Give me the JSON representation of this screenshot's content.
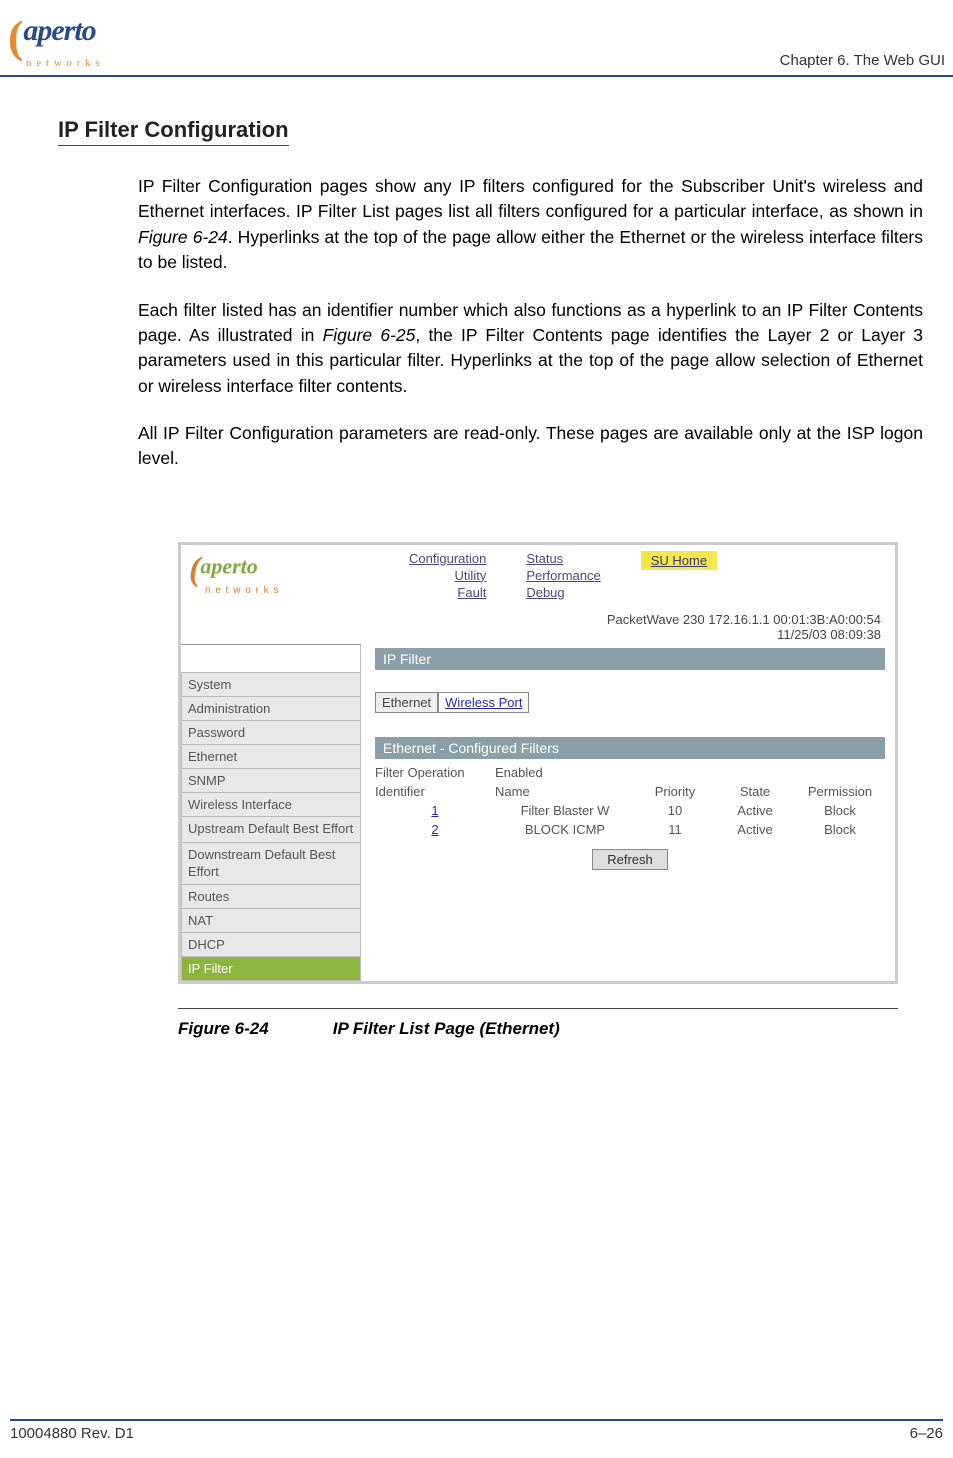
{
  "header": {
    "logo_paren": "(",
    "logo_text": "aperto",
    "logo_sub": "n e t w o r k s",
    "chapter": "Chapter 6.  The Web GUI"
  },
  "section": {
    "title": "IP Filter Configuration",
    "p1_a": "IP Filter Configuration pages show any IP filters configured for the Subscriber Unit's wireless and Ethernet interfaces. IP Filter List pages list all filters configured for a particular interface, as shown in ",
    "p1_ref": "Figure 6-24",
    "p1_b": ". Hyperlinks at the top of the page allow either the Ethernet or the wireless interface filters to be listed.",
    "p2_a": "Each filter listed has an identifier number which also functions as a hyperlink to an IP Filter Contents page. As illustrated in ",
    "p2_ref": "Figure 6-25",
    "p2_b": ", the IP Filter Contents page identifies the Layer 2 or Layer 3 parameters used in this particular filter. Hyperlinks at the top of the page allow selection of Ethernet or wireless interface filter contents.",
    "p3": "All IP Filter Configuration parameters are read-only. These pages are available only at the ISP logon level."
  },
  "screenshot": {
    "logo_paren": "(",
    "logo_text": "aperto",
    "logo_sub": "n e t w o r k s",
    "nav1": [
      "Configuration",
      "Utility",
      "Fault"
    ],
    "nav2": [
      "Status",
      "Performance",
      "Debug"
    ],
    "su_home": "SU Home",
    "info_line1": "PacketWave 230    172.16.1.1    00:01:3B:A0:00:54",
    "info_line2": "11/25/03    08:09:38",
    "sidebar": [
      "System",
      "Administration",
      "Password",
      "Ethernet",
      "SNMP",
      "Wireless Interface",
      "Upstream Default Best Effort",
      "Downstream Default Best Effort",
      "Routes",
      "NAT",
      "DHCP",
      "IP Filter"
    ],
    "crumb": "IP Filter",
    "tabs": {
      "active": "Ethernet",
      "link": "Wireless Port"
    },
    "panel_header": "Ethernet    - Configured Filters",
    "filter_op_label": "Filter Operation",
    "filter_op_value": "Enabled",
    "cols": {
      "id": "Identifier",
      "name": "Name",
      "prio": "Priority",
      "state": "State",
      "perm": "Permission"
    },
    "rows": [
      {
        "id": "1",
        "name": "Filter Blaster W",
        "prio": "10",
        "state": "Active",
        "perm": "Block"
      },
      {
        "id": "2",
        "name": "BLOCK ICMP",
        "prio": "11",
        "state": "Active",
        "perm": "Block"
      }
    ],
    "refresh": "Refresh"
  },
  "figure": {
    "num": "Figure 6-24",
    "title": "IP Filter List Page (Ethernet)"
  },
  "footer": {
    "left": "10004880 Rev. D1",
    "right": "6–26"
  },
  "chart_data": {
    "type": "table",
    "title": "Ethernet - Configured Filters",
    "columns": [
      "Identifier",
      "Name",
      "Priority",
      "State",
      "Permission"
    ],
    "rows": [
      [
        1,
        "Filter Blaster W",
        10,
        "Active",
        "Block"
      ],
      [
        2,
        "BLOCK ICMP",
        11,
        "Active",
        "Block"
      ]
    ]
  }
}
